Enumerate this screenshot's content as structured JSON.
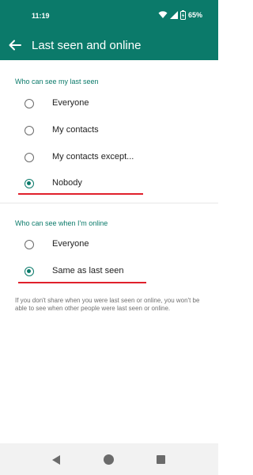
{
  "status_bar": {
    "time": "11:19",
    "battery": "65%"
  },
  "app_bar": {
    "title": "Last seen and online"
  },
  "last_seen": {
    "header": "Who can see my last seen",
    "options": [
      "Everyone",
      "My contacts",
      "My contacts except...",
      "Nobody"
    ],
    "selected": "Nobody"
  },
  "online": {
    "header": "Who can see when I'm online",
    "options": [
      "Everyone",
      "Same as last seen"
    ],
    "selected": "Same as last seen"
  },
  "footnote": "If you don't share when you were last seen or online, you won't be able to see when other people were last seen or online.",
  "colors": {
    "accent": "#0b7a6a",
    "annotation": "#e0202b"
  },
  "icons": {
    "status": [
      "wifi-icon",
      "signal-icon",
      "battery-icon"
    ],
    "back": "arrow-left-icon",
    "nav": [
      "nav-back-icon",
      "nav-home-icon",
      "nav-recents-icon"
    ]
  }
}
